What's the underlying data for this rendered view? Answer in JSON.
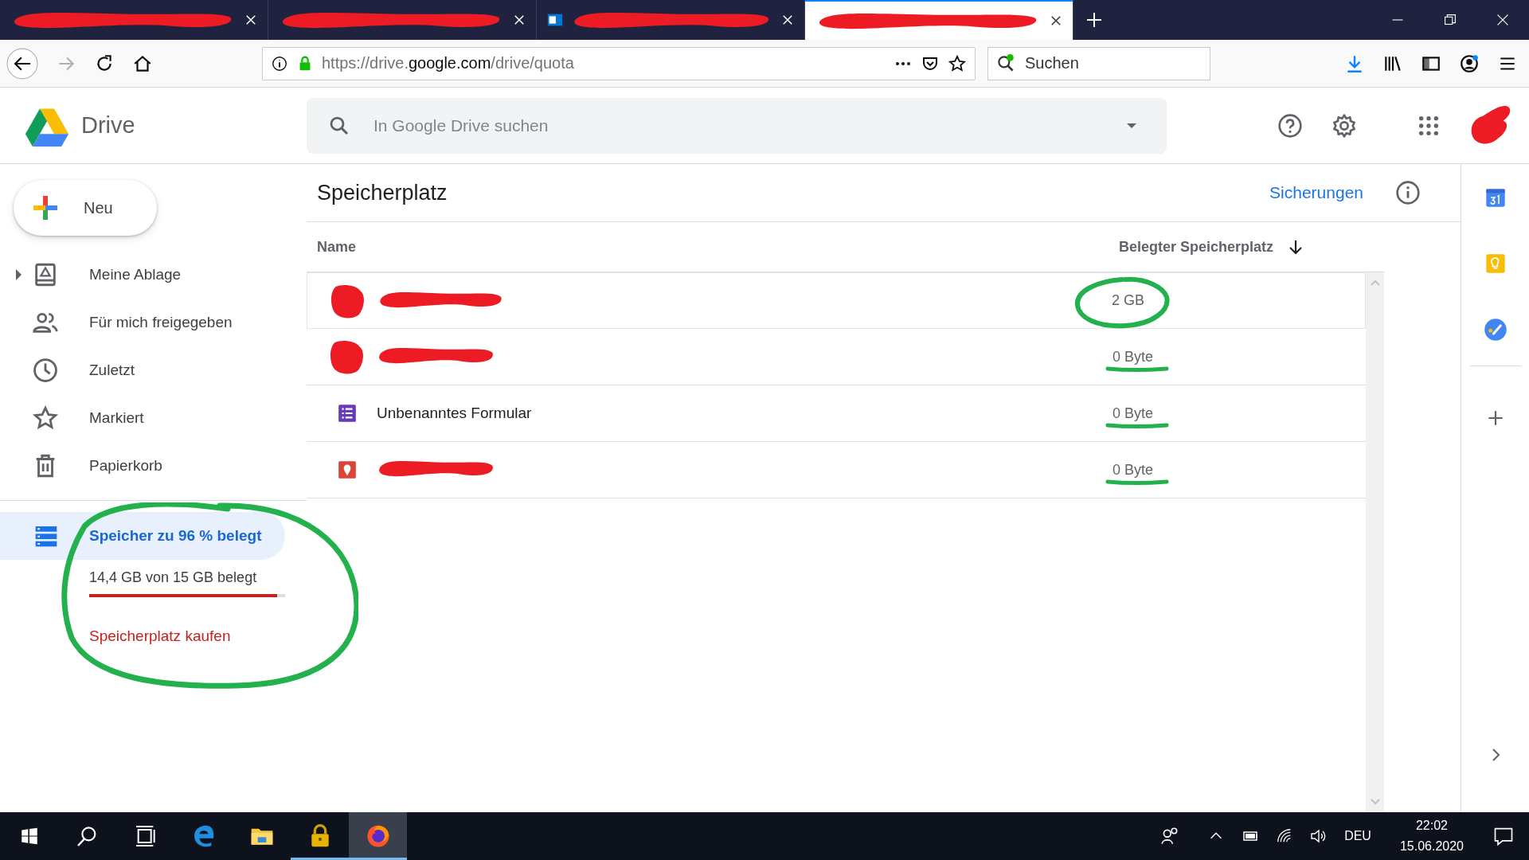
{
  "browser": {
    "tabs": [
      {
        "kind": "plain",
        "redacted": true,
        "selected": false
      },
      {
        "kind": "plain",
        "redacted": true,
        "selected": false
      },
      {
        "kind": "mail",
        "redacted": true,
        "selected": false
      },
      {
        "kind": "plain",
        "redacted": true,
        "selected": true
      }
    ],
    "address_bar": {
      "url_scheme": "https://drive.",
      "url_domain": "google.com",
      "url_path": "/drive/quota"
    },
    "search": {
      "placeholder": "Suchen"
    }
  },
  "drive": {
    "app_name": "Drive",
    "search": {
      "placeholder": "In Google Drive suchen"
    },
    "avatar": {
      "redacted": true
    }
  },
  "sidebar": {
    "new_button": "Neu",
    "items": [
      {
        "label": "Meine Ablage",
        "kind": "my_drive",
        "has_children": true
      },
      {
        "label": "Für mich freigegeben",
        "kind": "shared",
        "has_children": false
      },
      {
        "label": "Zuletzt",
        "kind": "recent",
        "has_children": false
      },
      {
        "label": "Markiert",
        "kind": "starred",
        "has_children": false
      },
      {
        "label": "Papierkorb",
        "kind": "trash",
        "has_children": false
      }
    ],
    "storage": {
      "label": "Speicher zu 96 % belegt",
      "selected": true,
      "usage": "14,4 GB von 15 GB belegt",
      "level": 0.96,
      "buy_link": "Speicherplatz kaufen",
      "circled": true
    }
  },
  "content": {
    "title": "Speicherplatz",
    "backups_link": "Sicherungen",
    "columns": [
      {
        "label": "Name",
        "sorted": false
      },
      {
        "label": "Belegter Speicherplatz",
        "sorted": true
      }
    ],
    "rows": [
      {
        "kind": "redacted",
        "redacted": true,
        "size": "2 GB",
        "circled": true,
        "underlined": false,
        "selected": true
      },
      {
        "kind": "redacted",
        "redacted": true,
        "size": "0 Byte",
        "circled": false,
        "underlined": true,
        "selected": false
      },
      {
        "kind": "form",
        "name": "Unbenanntes Formular",
        "redacted": false,
        "size": "0 Byte",
        "circled": false,
        "underlined": true,
        "selected": false
      },
      {
        "kind": "map",
        "redacted": true,
        "size": "0 Byte",
        "circled": false,
        "underlined": true,
        "selected": false
      }
    ]
  },
  "taskbar": {
    "apps": [
      {
        "kind": "start",
        "running": false,
        "active": false
      },
      {
        "kind": "search",
        "running": false,
        "active": false
      },
      {
        "kind": "task_view",
        "running": false,
        "active": false
      },
      {
        "kind": "edge",
        "running": false,
        "active": false
      },
      {
        "kind": "explorer",
        "running": false,
        "active": false
      },
      {
        "kind": "lock",
        "running": true,
        "active": false
      },
      {
        "kind": "firefox",
        "running": true,
        "active": true
      }
    ],
    "language": "DEU",
    "time": "22:02",
    "date": "15.06.2020"
  }
}
